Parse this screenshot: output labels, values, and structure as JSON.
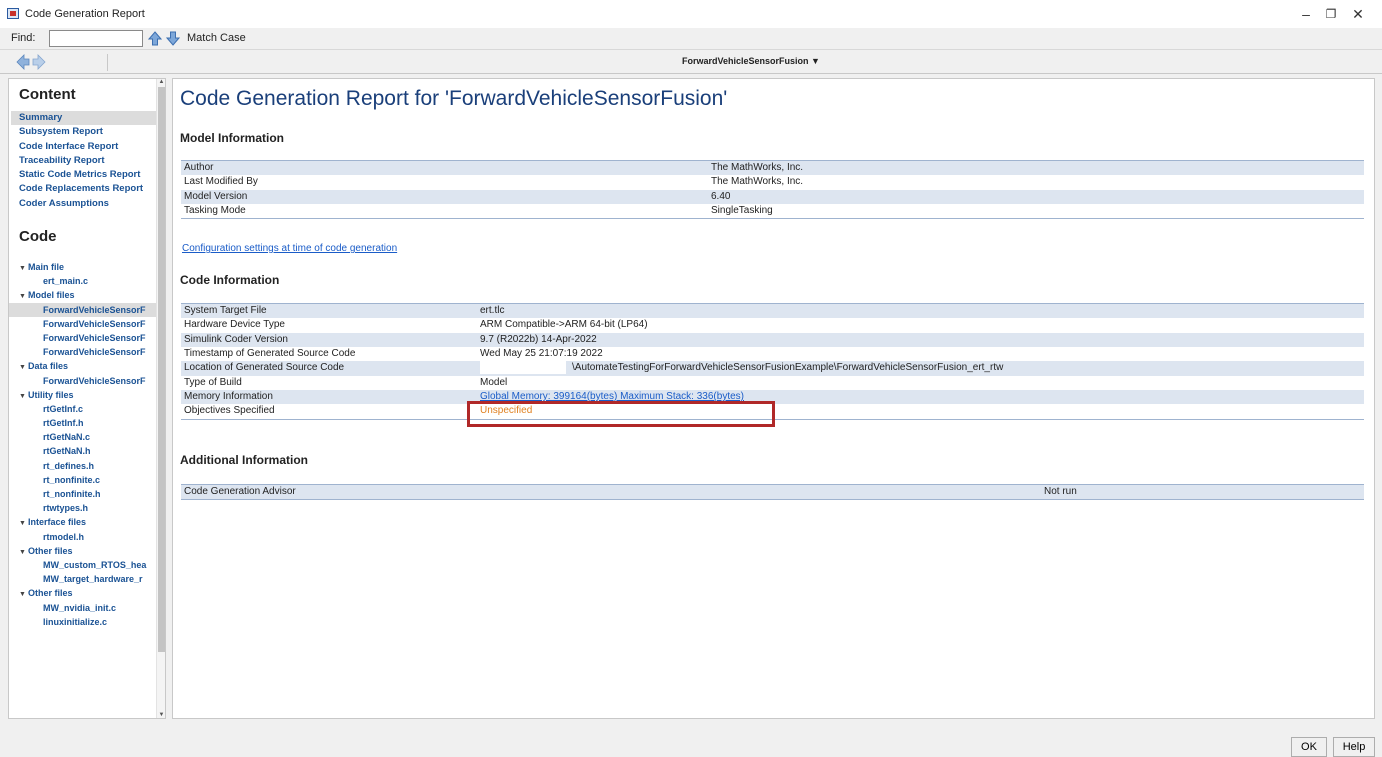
{
  "window": {
    "title": "Code Generation Report"
  },
  "findbar": {
    "label": "Find:",
    "value": "",
    "match_case": "Match Case"
  },
  "navbar": {
    "breadcrumb": "ForwardVehicleSensorFusion ▼"
  },
  "sidebar": {
    "content_heading": "Content",
    "content_items": [
      "Summary",
      "Subsystem Report",
      "Code Interface Report",
      "Traceability Report",
      "Static Code Metrics Report",
      "Code Replacements Report",
      "Coder Assumptions"
    ],
    "code_heading": "Code",
    "groups": [
      {
        "label": "Main file",
        "files": [
          "ert_main.c"
        ]
      },
      {
        "label": "Model files",
        "files": [
          "ForwardVehicleSensorF",
          "ForwardVehicleSensorF",
          "ForwardVehicleSensorF",
          "ForwardVehicleSensorF"
        ]
      },
      {
        "label": "Data files",
        "files": [
          "ForwardVehicleSensorF"
        ]
      },
      {
        "label": "Utility files",
        "files": [
          "rtGetInf.c",
          "rtGetInf.h",
          "rtGetNaN.c",
          "rtGetNaN.h",
          "rt_defines.h",
          "rt_nonfinite.c",
          "rt_nonfinite.h",
          "rtwtypes.h"
        ]
      },
      {
        "label": "Interface files",
        "files": [
          "rtmodel.h"
        ]
      },
      {
        "label": "Other files",
        "files": [
          "MW_custom_RTOS_hea",
          "MW_target_hardware_r"
        ]
      },
      {
        "label": "Other files",
        "files": [
          "MW_nvidia_init.c",
          "linuxinitialize.c"
        ]
      }
    ]
  },
  "report": {
    "title": "Code Generation Report for 'ForwardVehicleSensorFusion'",
    "model_info_heading": "Model Information",
    "model_info": [
      [
        "Author",
        "The MathWorks, Inc."
      ],
      [
        "Last Modified By",
        "The MathWorks, Inc."
      ],
      [
        "Model Version",
        "6.40"
      ],
      [
        "Tasking Mode",
        "SingleTasking"
      ]
    ],
    "config_link": "Configuration settings at time of code generation",
    "code_info_heading": "Code Information",
    "code_info": [
      [
        "System Target File",
        "ert.tlc"
      ],
      [
        "Hardware Device Type",
        "ARM Compatible->ARM 64-bit (LP64)"
      ],
      [
        "Simulink Coder Version",
        "9.7 (R2022b) 14-Apr-2022"
      ],
      [
        "Timestamp of Generated Source Code",
        "Wed May 25 21:07:19 2022"
      ],
      [
        "Location of Generated Source Code",
        "\\AutomateTestingForForwardVehicleSensorFusionExample\\ForwardVehicleSensorFusion_ert_rtw"
      ],
      [
        "Type of Build",
        "Model"
      ],
      [
        "Memory Information",
        "Global Memory: 399164(bytes) Maximum Stack: 336(bytes)"
      ],
      [
        "Objectives Specified",
        "Unspecified"
      ]
    ],
    "additional_heading": "Additional Information",
    "additional_info": [
      [
        "Code Generation Advisor",
        "Not run"
      ]
    ]
  },
  "footer": {
    "ok": "OK",
    "help": "Help"
  }
}
